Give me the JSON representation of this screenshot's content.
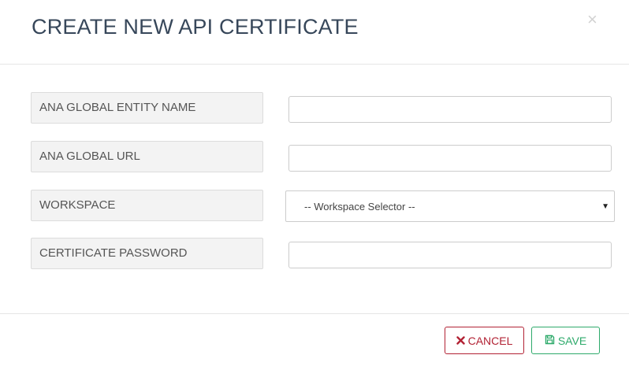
{
  "modal": {
    "title": "CREATE NEW API CERTIFICATE",
    "close_symbol": "×"
  },
  "form": {
    "fields": [
      {
        "label": "ANA GLOBAL ENTITY NAME",
        "type": "text",
        "value": "",
        "placeholder": ""
      },
      {
        "label": "ANA GLOBAL URL",
        "type": "text",
        "value": "",
        "placeholder": ""
      },
      {
        "label": "WORKSPACE",
        "type": "select",
        "selected": "-- Workspace Selector --"
      },
      {
        "label": "CERTIFICATE PASSWORD",
        "type": "password",
        "value": "",
        "placeholder": ""
      }
    ]
  },
  "footer": {
    "cancel_label": "CANCEL",
    "cancel_icon": "times-icon",
    "save_label": "SAVE",
    "save_icon": "floppy-disk-icon"
  },
  "colors": {
    "title": "#37475a",
    "cancel": "#b22234",
    "save": "#2eaa6b"
  }
}
